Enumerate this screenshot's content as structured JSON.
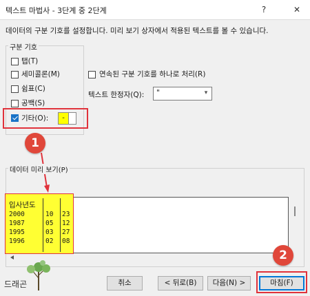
{
  "window": {
    "title": "텍스트 마법사 - 3단계 중 2단계",
    "help_label": "?",
    "close_label": "✕"
  },
  "description": "데이터의 구분 기호를 설정합니다. 미리 보기 상자에서 적용된 텍스트를 볼 수 있습니다.",
  "delimiters": {
    "legend": "구분 기호",
    "items": [
      {
        "label": "탭(T)",
        "checked": false
      },
      {
        "label": "세미콜론(M)",
        "checked": false
      },
      {
        "label": "쉼표(C)",
        "checked": false
      },
      {
        "label": "공백(S)",
        "checked": false
      },
      {
        "label": "기타(O):",
        "checked": true
      }
    ],
    "other_value": "-"
  },
  "options": {
    "consecutive_label": "연속된 구분 기호를 하나로 처리(R)",
    "qualifier_label": "텍스트 한정자(Q):",
    "qualifier_value": "\""
  },
  "preview": {
    "legend": "데이터 미리 보기(P)",
    "header": "입사년도",
    "columns": [
      [
        "2000",
        "1987",
        "1995",
        "1996"
      ],
      [
        "10",
        "05",
        "03",
        "02"
      ],
      [
        "23",
        "12",
        "27",
        "08"
      ]
    ]
  },
  "annotations": {
    "badge1": "1",
    "badge2": "2"
  },
  "buttons": {
    "cancel": "취소",
    "back": "< 뒤로(B)",
    "next": "다음(N) >",
    "finish": "마침(F)"
  },
  "logo_text": "드래곤",
  "colors": {
    "accent": "#1a73c7",
    "highlight_red": "#e0323b",
    "highlight_yellow": "#ffff33",
    "badge": "#e0473a"
  }
}
